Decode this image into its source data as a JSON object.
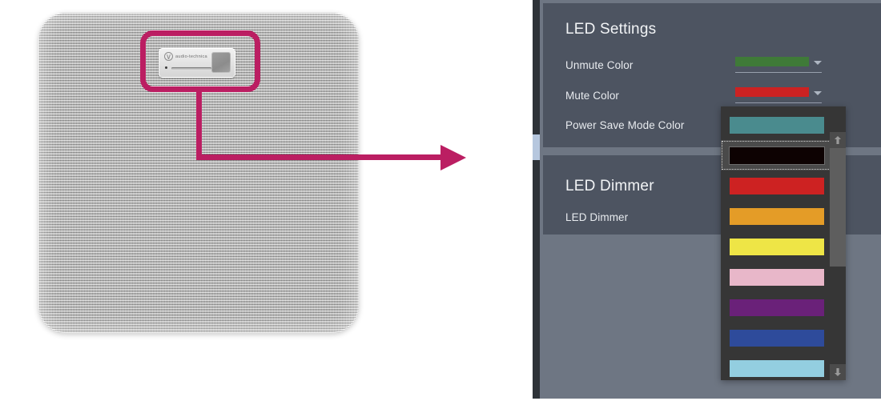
{
  "figure": {
    "device_name": "ceiling-array-microphone",
    "brand_text": "audio-technica",
    "logo_icon": "audio-technica-logo-icon",
    "ir_window_name": "ir-window",
    "led_indicator_name": "led-indicator",
    "callout_color": "#bb1e62"
  },
  "panel": {
    "background": "#6e7683",
    "card_background": "#4d5461",
    "sections": [
      {
        "title": "LED Settings",
        "fields": [
          {
            "label": "Unmute Color",
            "value_color": "#3f7a38",
            "control": "color-dropdown"
          },
          {
            "label": "Mute Color",
            "value_color": "#cc2222",
            "control": "color-dropdown"
          },
          {
            "label": "Power Save Mode Color",
            "value_color": "#4a8b8e",
            "control": "color-dropdown"
          }
        ]
      },
      {
        "title": "LED Dimmer",
        "fields": [
          {
            "label": "LED Dimmer",
            "value_color": "",
            "control": "slider"
          }
        ]
      }
    ]
  },
  "dropdown": {
    "name": "power-save-mode-color-dropdown",
    "selected_index": 1,
    "options": [
      {
        "name": "teal",
        "color": "#4a8b8e"
      },
      {
        "name": "black",
        "color": "#0d0202"
      },
      {
        "name": "red",
        "color": "#cd2222"
      },
      {
        "name": "orange",
        "color": "#e49c27"
      },
      {
        "name": "yellow",
        "color": "#eee546"
      },
      {
        "name": "pink",
        "color": "#e8b7c9"
      },
      {
        "name": "purple",
        "color": "#6a2179"
      },
      {
        "name": "blue",
        "color": "#2e4b9b"
      },
      {
        "name": "lightblue",
        "color": "#93cee0"
      }
    ],
    "scroll_up_icon": "arrow-up-icon",
    "scroll_down_icon": "arrow-down-icon"
  }
}
